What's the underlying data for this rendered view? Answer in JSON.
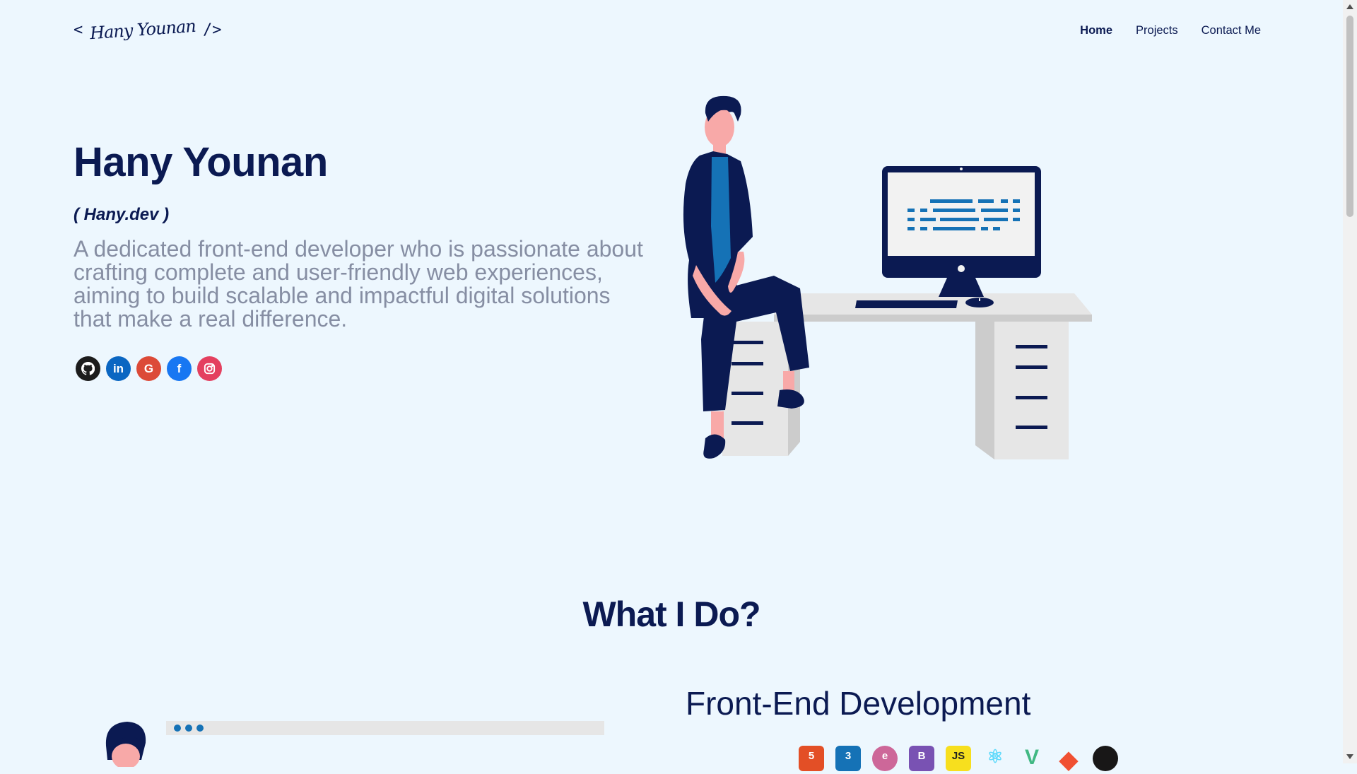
{
  "header": {
    "logo": {
      "open": "<",
      "signature": "Hany Younan",
      "close": "/>"
    },
    "nav": [
      {
        "label": "Home",
        "active": true
      },
      {
        "label": "Projects",
        "active": false
      },
      {
        "label": "Contact Me",
        "active": false
      }
    ]
  },
  "hero": {
    "name": "Hany Younan",
    "alias": "( Hany.dev )",
    "description": "A dedicated front-end developer who is passionate about crafting complete and user-friendly web experiences, aiming to build scalable and impactful digital solutions that make a real difference.",
    "socials": [
      {
        "icon": "github-icon",
        "color": "#1c1c1c"
      },
      {
        "icon": "linkedin-icon",
        "color": "#0a66c2",
        "glyph": "in"
      },
      {
        "icon": "google-icon",
        "color": "#dc4a38",
        "glyph": "G"
      },
      {
        "icon": "facebook-icon",
        "color": "#1877f2",
        "glyph": "f"
      },
      {
        "icon": "instagram-icon",
        "color": "#e4405f"
      }
    ]
  },
  "what_i_do": {
    "title": "What I Do?",
    "skills": [
      {
        "title": "Front-End Development",
        "tech_icons": [
          {
            "icon": "html5-icon",
            "color": "#e34f26",
            "glyph": "5"
          },
          {
            "icon": "css3-icon",
            "color": "#1572b6",
            "glyph": "3"
          },
          {
            "icon": "sass-icon",
            "color": "#cd6799",
            "glyph": "e"
          },
          {
            "icon": "bootstrap-icon",
            "color": "#7952b3",
            "glyph": "B"
          },
          {
            "icon": "javascript-icon",
            "color": "#f7df1e",
            "glyph": "JS"
          },
          {
            "icon": "react-icon",
            "color": "#61dafb",
            "glyph": "⚛"
          },
          {
            "icon": "vue-icon",
            "color": "#41b883",
            "glyph": "V"
          },
          {
            "icon": "git-icon",
            "color": "#f05032",
            "glyph": "◆"
          },
          {
            "icon": "github-icon",
            "color": "#181717",
            "glyph": ""
          }
        ]
      }
    ]
  }
}
